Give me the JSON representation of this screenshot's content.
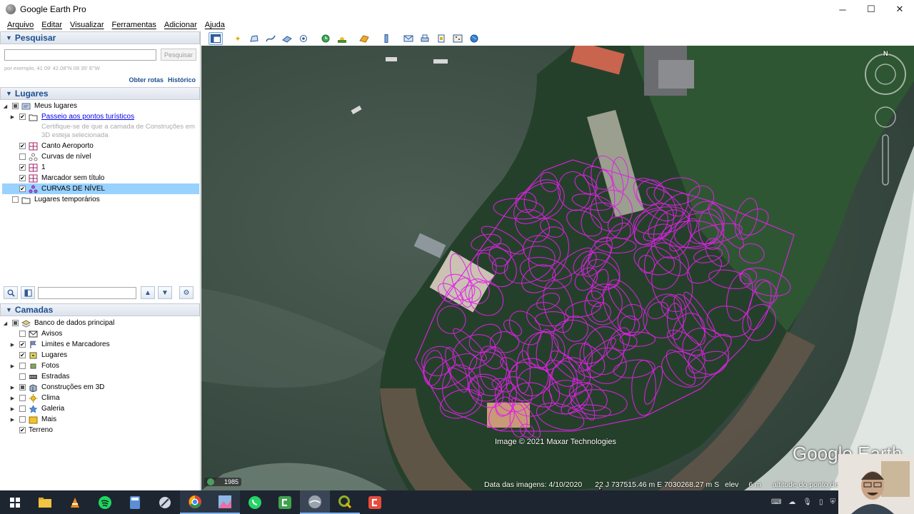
{
  "window": {
    "title": "Google Earth Pro",
    "minimize": "─",
    "maximize": "☐",
    "close": "✕"
  },
  "menu": [
    "Arquivo",
    "Editar",
    "Visualizar",
    "Ferramentas",
    "Adicionar",
    "Ajuda"
  ],
  "search_panel": {
    "title": "Pesquisar",
    "input_value": "",
    "button": "Pesquisar",
    "hint": "por exemplo, 41 09' 42.08\"N 08 35' E\"W",
    "link_routes": "Obter rotas",
    "link_history": "Histórico"
  },
  "places_panel": {
    "title": "Lugares",
    "items": {
      "my_places": "Meus lugares",
      "tour": "Passeio aos pontos turísticos",
      "tour_desc": "Certifique-se de que a camada de Construções em 3D esteja selecionada",
      "canto": "Canto Aeroporto",
      "curvas": "Curvas de nível",
      "one": "1",
      "marker": "Marcador sem título",
      "curvas_caps": "CURVAS DE NÍVEL",
      "temp": "Lugares temporários"
    },
    "filter_value": ""
  },
  "layers_panel": {
    "title": "Camadas",
    "items": {
      "db": "Banco de dados principal",
      "avisos": "Avisos",
      "limites": "Limites e Marcadores",
      "lugares": "Lugares",
      "fotos": "Fotos",
      "estradas": "Estradas",
      "construcoes": "Construções em 3D",
      "clima": "Clima",
      "galeria": "Galeria",
      "mais": "Mais",
      "terreno": "Terreno"
    }
  },
  "map": {
    "attribution": "Image © 2021 Maxar Technologies",
    "brand": "Google Earth",
    "year": "1985",
    "status_date": "Data das imagens: 4/10/2020",
    "status_coords": "22 J 737515.46 m E 7030268.27 m S",
    "status_elev_label": "elev",
    "status_elev": "6 m",
    "status_alt": "altitude do ponto de",
    "compass_n": "N",
    "contour_color": "#e020e8"
  }
}
